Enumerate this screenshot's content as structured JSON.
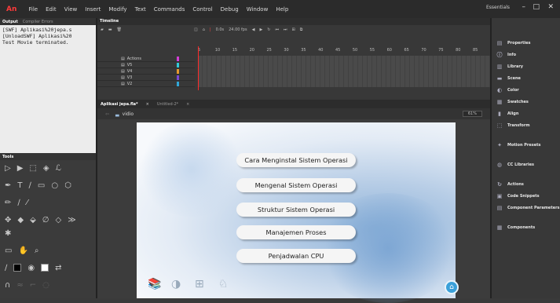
{
  "app": {
    "logo": "An"
  },
  "menu": [
    "File",
    "Edit",
    "View",
    "Insert",
    "Modify",
    "Text",
    "Commands",
    "Control",
    "Debug",
    "Window",
    "Help"
  ],
  "workspace": "Essentials",
  "window_controls": [
    "–",
    "□",
    "✕"
  ],
  "output_panel": {
    "tabs": [
      "Output",
      "Compiler Errors"
    ],
    "lines": [
      "[SWF] Aplikasi%20jepa.s",
      "[UnloadSWF] Aplikasi%20",
      "Test Movie terminated."
    ]
  },
  "timeline": {
    "title": "Timeline",
    "fps": "24.00 fps",
    "frame": "0.0s",
    "ruler": [
      "5",
      "10",
      "15",
      "20",
      "25",
      "30",
      "35",
      "40",
      "45",
      "50",
      "55",
      "60",
      "65",
      "70",
      "75",
      "80",
      "85"
    ],
    "layers": [
      {
        "name": "Actions",
        "color": "#d33fd6"
      },
      {
        "name": "V5",
        "color": "#32c9d8"
      },
      {
        "name": "V4",
        "color": "#e59a2e"
      },
      {
        "name": "V3",
        "color": "#7a49d4"
      },
      {
        "name": "V2",
        "color": "#31a7d8"
      }
    ]
  },
  "doc_tabs": [
    "Aplikasi jepa.fla*",
    "Untitled-2*"
  ],
  "scene": {
    "name": "vidio",
    "zoom": "61%"
  },
  "stage": {
    "menu_buttons": [
      "Cara Menginstal Sistem Operasi",
      "Mengenal Sistem Operasi",
      "Struktur Sistem Operasi",
      "Manajemen Proses",
      "Penjadwalan CPU"
    ]
  },
  "tools_panel": {
    "title": "Tools"
  },
  "right_panel": {
    "group1": [
      "Properties",
      "Info",
      "Library",
      "Scene",
      "Color",
      "Swatches",
      "Align",
      "Transform"
    ],
    "group2": [
      "Motion Presets"
    ],
    "group3": [
      "CC Libraries"
    ],
    "group4": [
      "Actions",
      "Code Snippets",
      "Component Parameters"
    ],
    "group5": [
      "Components"
    ]
  }
}
